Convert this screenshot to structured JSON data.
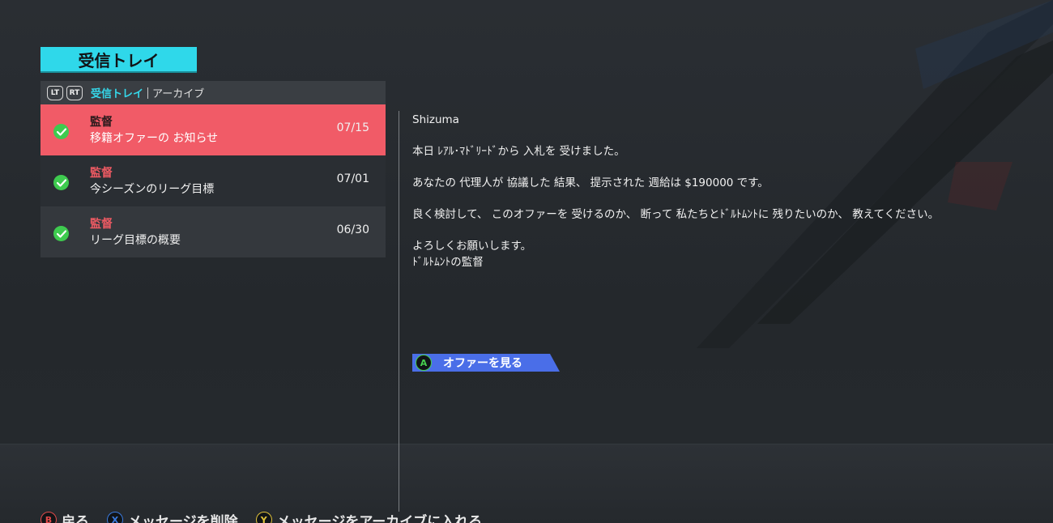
{
  "page": {
    "title": "受信トレイ"
  },
  "tabs": {
    "lt_label": "LT",
    "rt_label": "RT",
    "active": "受信トレイ",
    "inactive": "アーカイブ"
  },
  "messages": [
    {
      "sender": "監督",
      "subject": "移籍オファーの お知らせ",
      "date": "07/15",
      "selected": true
    },
    {
      "sender": "監督",
      "subject": "今シーズンのリーグ目標",
      "date": "07/01",
      "selected": false
    },
    {
      "sender": "監督",
      "subject": "リーグ目標の概要",
      "date": "06/30",
      "selected": false
    }
  ],
  "detail": {
    "sender": "Shizuma",
    "paragraph1": "本日 ﾚｱﾙ･ﾏﾄﾞﾘｰﾄﾞから 入札を 受けました。",
    "paragraph2": "あなたの 代理人が 協議した 結果、 提示された 週給は $190000 です。",
    "paragraph3": "良く検討して、 このオファーを 受けるのか、 断って 私たちとﾄﾞﾙﾄﾑﾝﾄに 残りたいのか、 教えてください。",
    "closing1": "よろしくお願いします。",
    "closing2": "ﾄﾞﾙﾄﾑﾝﾄの監督",
    "offer_button_glyph": "A",
    "offer_button_label": "オファーを見る"
  },
  "footer": [
    {
      "glyph": "B",
      "label": "戻る"
    },
    {
      "glyph": "X",
      "label": "メッセージを削除"
    },
    {
      "glyph": "Y",
      "label": "メッセージをアーカイブに入れる"
    }
  ],
  "colors": {
    "accent_cyan": "#2fd8ea",
    "selected_row": "#f15b67",
    "offer_button": "#4a6ee8",
    "check_green": "#3ecb4f"
  }
}
